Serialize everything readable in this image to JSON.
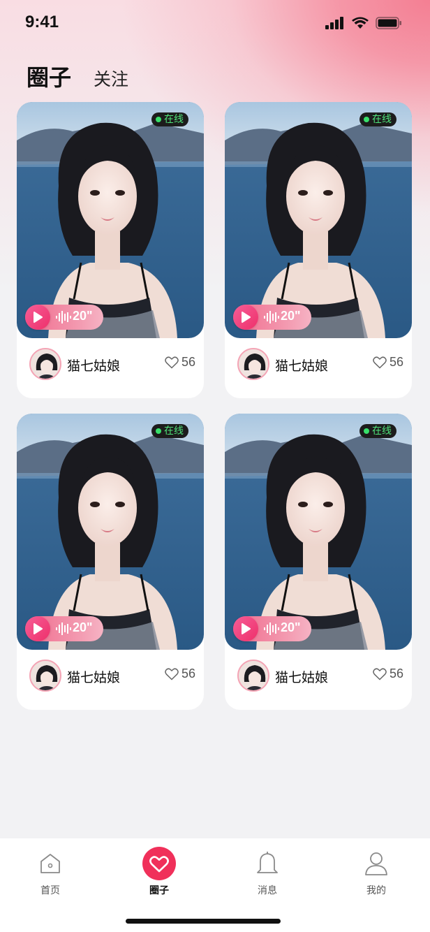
{
  "status_bar": {
    "time": "9:41"
  },
  "header": {
    "tab_active": "圈子",
    "tab_follow": "关注"
  },
  "cards": [
    {
      "username": "猫七姑娘",
      "likes": "56",
      "online": "在线",
      "voice_duration": "20\""
    },
    {
      "username": "猫七姑娘",
      "likes": "56",
      "online": "在线",
      "voice_duration": "20\""
    },
    {
      "username": "猫七姑娘",
      "likes": "56",
      "online": "在线",
      "voice_duration": "20\""
    },
    {
      "username": "猫七姑娘",
      "likes": "56",
      "online": "在线",
      "voice_duration": "20\""
    }
  ],
  "tab_bar": {
    "items": [
      {
        "label": "首页",
        "icon": "home-icon"
      },
      {
        "label": "圈子",
        "icon": "heart-icon"
      },
      {
        "label": "消息",
        "icon": "bell-icon"
      },
      {
        "label": "我的",
        "icon": "user-icon"
      }
    ],
    "active_color": "#f0305a"
  }
}
